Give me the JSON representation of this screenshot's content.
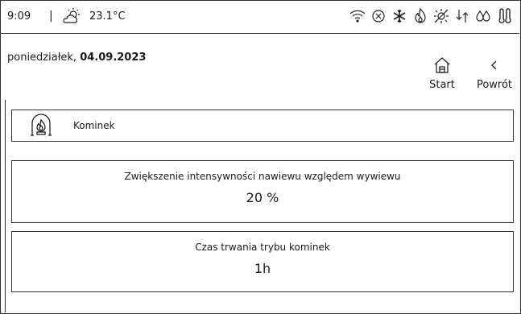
{
  "status_bar": {
    "time": "9:09",
    "separator": "|",
    "temperature": "23.1°C",
    "icons": [
      "wifi-icon",
      "close-circle-icon",
      "snowflake-icon",
      "flame-icon",
      "sun-off-icon",
      "airflow-icon",
      "humidity-icon",
      "thermostat-icon"
    ]
  },
  "header": {
    "day": "poniedziałek,",
    "date": "04.09.2023",
    "start_label": "Start",
    "back_label": "Powrót"
  },
  "mode": {
    "label": "Kominek"
  },
  "params": [
    {
      "title": "Zwiększenie intensywności nawiewu względem wywiewu",
      "value": "20 %"
    },
    {
      "title": "Czas trwania trybu kominek",
      "value": "1h"
    }
  ]
}
